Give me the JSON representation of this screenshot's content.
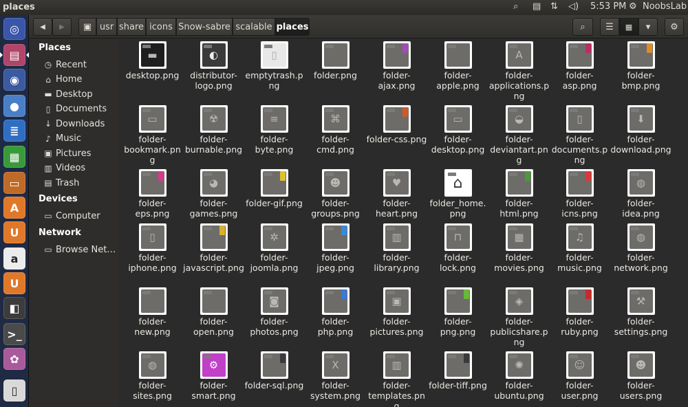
{
  "window_title": "places",
  "topbar": {
    "clock": "5:53 PM",
    "user": "NoobsLab",
    "icons": [
      "search-icon",
      "clipboard-icon",
      "network-icon",
      "volume-icon",
      "gear-icon"
    ]
  },
  "launcher": {
    "items": [
      {
        "name": "dash-home",
        "glyph": "◎",
        "color": "#3a56a8"
      },
      {
        "name": "files",
        "glyph": "▤",
        "color": "#b0456a"
      },
      {
        "name": "firefox",
        "glyph": "◉",
        "color": "#3b5aa0"
      },
      {
        "name": "chromium",
        "glyph": "●",
        "color": "#4a7fc8"
      },
      {
        "name": "writer",
        "glyph": "≣",
        "color": "#2f6ec0"
      },
      {
        "name": "calc",
        "glyph": "▦",
        "color": "#3a9a3a"
      },
      {
        "name": "impress",
        "glyph": "▭",
        "color": "#c06a28"
      },
      {
        "name": "software-center",
        "glyph": "A",
        "color": "#e0782a"
      },
      {
        "name": "ubuntu-one",
        "glyph": "U",
        "color": "#e0782a"
      },
      {
        "name": "amazon",
        "glyph": "a",
        "color": "#ececec"
      },
      {
        "name": "ubuntu-one-music",
        "glyph": "U",
        "color": "#e0782a"
      },
      {
        "name": "system-monitor",
        "glyph": "◧",
        "color": "#3c3c3c"
      },
      {
        "name": "terminal",
        "glyph": ">_",
        "color": "#4a4a4a"
      },
      {
        "name": "settings",
        "glyph": "✿",
        "color": "#a85a9a"
      },
      {
        "name": "trash",
        "glyph": "▯",
        "color": "#d9d9d9"
      }
    ]
  },
  "toolbar": {
    "back": "◀",
    "forward": "▶",
    "crumbs": [
      "usr",
      "share",
      "icons",
      "Snow-sabre",
      "scalable",
      "places"
    ],
    "search": "⌕",
    "list_view": "☰",
    "grid_view": "▦",
    "dropdown": "▾",
    "settings": "⚙"
  },
  "sidebar": {
    "places_heading": "Places",
    "places": [
      {
        "label": "Recent",
        "icon": "◷"
      },
      {
        "label": "Home",
        "icon": "⌂"
      },
      {
        "label": "Desktop",
        "icon": "▬"
      },
      {
        "label": "Documents",
        "icon": "▯"
      },
      {
        "label": "Downloads",
        "icon": "↓"
      },
      {
        "label": "Music",
        "icon": "♪"
      },
      {
        "label": "Pictures",
        "icon": "▣"
      },
      {
        "label": "Videos",
        "icon": "▥"
      },
      {
        "label": "Trash",
        "icon": "▤"
      }
    ],
    "devices_heading": "Devices",
    "devices": [
      {
        "label": "Computer",
        "icon": "▭"
      }
    ],
    "network_heading": "Network",
    "network": [
      {
        "label": "Browse Net…",
        "icon": "▭"
      }
    ]
  },
  "files": [
    {
      "name": "desktop.png",
      "glyph": "▬",
      "badge": ""
    },
    {
      "name": "distributor-logo.png",
      "glyph": "◐",
      "badge": ""
    },
    {
      "name": "emptytrash.png",
      "glyph": "▯",
      "badge": ""
    },
    {
      "name": "folder.png",
      "glyph": "",
      "badge": ""
    },
    {
      "name": "folder-ajax.png",
      "glyph": "",
      "badge": "#a54ab8"
    },
    {
      "name": "folder-apple.png",
      "glyph": "",
      "badge": ""
    },
    {
      "name": "folder-applications.png",
      "glyph": "A",
      "badge": ""
    },
    {
      "name": "folder-asp.png",
      "glyph": "",
      "badge": "#b83060"
    },
    {
      "name": "folder-bmp.png",
      "glyph": "",
      "badge": "#e08a28"
    },
    {
      "name": "folder-bookmark.png",
      "glyph": "▭",
      "badge": ""
    },
    {
      "name": "folder-burnable.png",
      "glyph": "☢",
      "badge": ""
    },
    {
      "name": "folder-byte.png",
      "glyph": "≡",
      "badge": ""
    },
    {
      "name": "folder-cmd.png",
      "glyph": "⌘",
      "badge": ""
    },
    {
      "name": "folder-css.png",
      "glyph": "",
      "badge": "#d05a28"
    },
    {
      "name": "folder-desktop.png",
      "glyph": "▭",
      "badge": ""
    },
    {
      "name": "folder-deviantart.png",
      "glyph": "◒",
      "badge": ""
    },
    {
      "name": "folder-documents.png",
      "glyph": "▯",
      "badge": ""
    },
    {
      "name": "folder-download.png",
      "glyph": "⬇",
      "badge": ""
    },
    {
      "name": "folder-eps.png",
      "glyph": "",
      "badge": "#d83a8a"
    },
    {
      "name": "folder-games.png",
      "glyph": "◕",
      "badge": ""
    },
    {
      "name": "folder-gif.png",
      "glyph": "",
      "badge": "#e0c030"
    },
    {
      "name": "folder-groups.png",
      "glyph": "☻",
      "badge": ""
    },
    {
      "name": "folder-heart.png",
      "glyph": "♥",
      "badge": ""
    },
    {
      "name": "folder_home.png",
      "glyph": "⌂",
      "badge": ""
    },
    {
      "name": "folder-html.png",
      "glyph": "",
      "badge": "#4a9a3a"
    },
    {
      "name": "folder-icns.png",
      "glyph": "",
      "badge": "#d83a3a"
    },
    {
      "name": "folder-idea.png",
      "glyph": "◍",
      "badge": ""
    },
    {
      "name": "folder-iphone.png",
      "glyph": "▯",
      "badge": ""
    },
    {
      "name": "folder-javascript.png",
      "glyph": "",
      "badge": "#d8b030"
    },
    {
      "name": "folder-joomla.png",
      "glyph": "✲",
      "badge": ""
    },
    {
      "name": "folder-jpeg.png",
      "glyph": "",
      "badge": "#3a8ad8"
    },
    {
      "name": "folder-library.png",
      "glyph": "▥",
      "badge": ""
    },
    {
      "name": "folder-lock.png",
      "glyph": "⊓",
      "badge": ""
    },
    {
      "name": "folder-movies.png",
      "glyph": "▦",
      "badge": ""
    },
    {
      "name": "folder-music.png",
      "glyph": "♫",
      "badge": ""
    },
    {
      "name": "folder-network.png",
      "glyph": "◍",
      "badge": ""
    },
    {
      "name": "folder-new.png",
      "glyph": "",
      "badge": ""
    },
    {
      "name": "folder-open.png",
      "glyph": "",
      "badge": ""
    },
    {
      "name": "folder-photos.png",
      "glyph": "◙",
      "badge": ""
    },
    {
      "name": "folder-php.png",
      "glyph": "",
      "badge": "#3a7ad8"
    },
    {
      "name": "folder-pictures.png",
      "glyph": "▣",
      "badge": ""
    },
    {
      "name": "folder-png.png",
      "glyph": "",
      "badge": "#6ab83a"
    },
    {
      "name": "folder-publicshare.png",
      "glyph": "◈",
      "badge": ""
    },
    {
      "name": "folder-ruby.png",
      "glyph": "",
      "badge": "#c82a2a"
    },
    {
      "name": "folder-settings.png",
      "glyph": "⚒",
      "badge": ""
    },
    {
      "name": "folder-sites.png",
      "glyph": "◍",
      "badge": ""
    },
    {
      "name": "folder-smart.png",
      "glyph": "⚙",
      "badge": "#c040c8"
    },
    {
      "name": "folder-sql.png",
      "glyph": "",
      "badge": "#3a3a3a"
    },
    {
      "name": "folder-system.png",
      "glyph": "X",
      "badge": ""
    },
    {
      "name": "folder-templates.png",
      "glyph": "▥",
      "badge": ""
    },
    {
      "name": "folder-tiff.png",
      "glyph": "",
      "badge": "#3a3a3a"
    },
    {
      "name": "folder-ubuntu.png",
      "glyph": "✺",
      "badge": ""
    },
    {
      "name": "folder-user.png",
      "glyph": "☺",
      "badge": ""
    },
    {
      "name": "folder-users.png",
      "glyph": "☻",
      "badge": ""
    }
  ]
}
